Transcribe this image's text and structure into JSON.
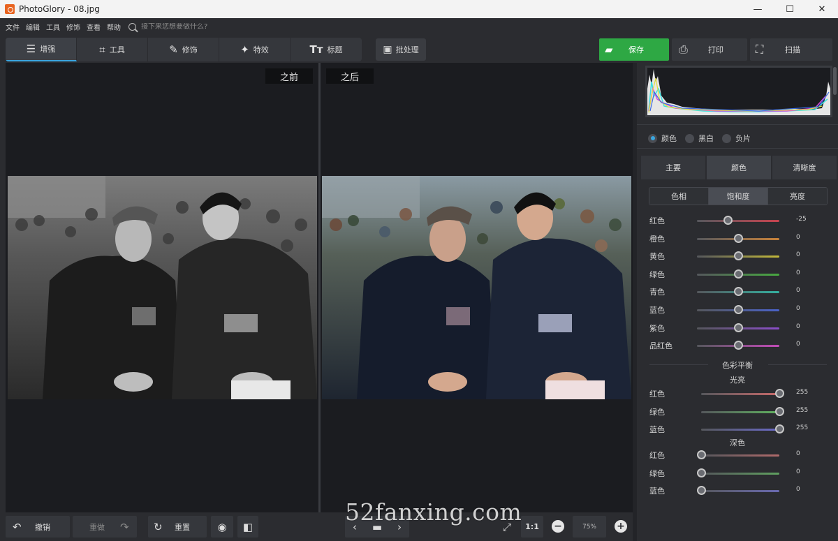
{
  "window": {
    "title": "PhotoGlory - 08.jpg",
    "minimize": "—",
    "maximize": "☐",
    "close": "✕"
  },
  "menu": {
    "items": [
      "文件",
      "编辑",
      "工具",
      "修饰",
      "查看",
      "帮助"
    ],
    "search_placeholder": "接下来您想要做什么?"
  },
  "toolbar": {
    "tabs": [
      {
        "label": "增强",
        "icon": "sliders-icon"
      },
      {
        "label": "工具",
        "icon": "crop-icon"
      },
      {
        "label": "修饰",
        "icon": "brush-icon"
      },
      {
        "label": "特效",
        "icon": "magic-wand-icon"
      },
      {
        "label": "标题",
        "icon": "text-icon"
      }
    ],
    "active_tab": "增强",
    "batch": "批处理",
    "save": "保存",
    "print": "打印",
    "scan": "扫描"
  },
  "canvas": {
    "before_label": "之前",
    "after_label": "之后"
  },
  "bottom": {
    "undo": "撤销",
    "redo": "重做",
    "reset": "重置",
    "ratio": "1:1",
    "zoom": "75%"
  },
  "watermark": "52fanxing.com",
  "panel": {
    "mode_options": [
      "颜色",
      "黑白",
      "负片"
    ],
    "mode_selected": "颜色",
    "tabs": [
      "主要",
      "颜色",
      "清晰度"
    ],
    "active_tab": "颜色",
    "segments": [
      "色相",
      "饱和度",
      "亮度"
    ],
    "active_segment": "饱和度",
    "saturation": [
      {
        "label": "红色",
        "value": "-25",
        "level": -25,
        "color": "#c8434f"
      },
      {
        "label": "橙色",
        "value": "0",
        "level": 0,
        "color": "#c8823a"
      },
      {
        "label": "黄色",
        "value": "0",
        "level": 0,
        "color": "#c2b83a"
      },
      {
        "label": "绿色",
        "value": "0",
        "level": 0,
        "color": "#47a840"
      },
      {
        "label": "青色",
        "value": "0",
        "level": 0,
        "color": "#34b0a0"
      },
      {
        "label": "蓝色",
        "value": "0",
        "level": 0,
        "color": "#4a62c8"
      },
      {
        "label": "紫色",
        "value": "0",
        "level": 0,
        "color": "#8a4ec8"
      },
      {
        "label": "品红色",
        "value": "0",
        "level": 0,
        "color": "#c24bb8"
      }
    ],
    "color_balance_title": "色彩平衡",
    "highlights_title": "光亮",
    "highlights": [
      {
        "label": "红色",
        "value": "255",
        "level": 255,
        "color": "#c86a6a"
      },
      {
        "label": "绿色",
        "value": "255",
        "level": 255,
        "color": "#5fb15f"
      },
      {
        "label": "蓝色",
        "value": "255",
        "level": 255,
        "color": "#6a6ac8"
      }
    ],
    "shadows_title": "深色",
    "shadows": [
      {
        "label": "红色",
        "value": "0",
        "level": 0,
        "color": "#b06a6a"
      },
      {
        "label": "绿色",
        "value": "0",
        "level": 0,
        "color": "#5fa05f"
      },
      {
        "label": "蓝色",
        "value": "0",
        "level": 0,
        "color": "#6a6ab0"
      }
    ]
  }
}
